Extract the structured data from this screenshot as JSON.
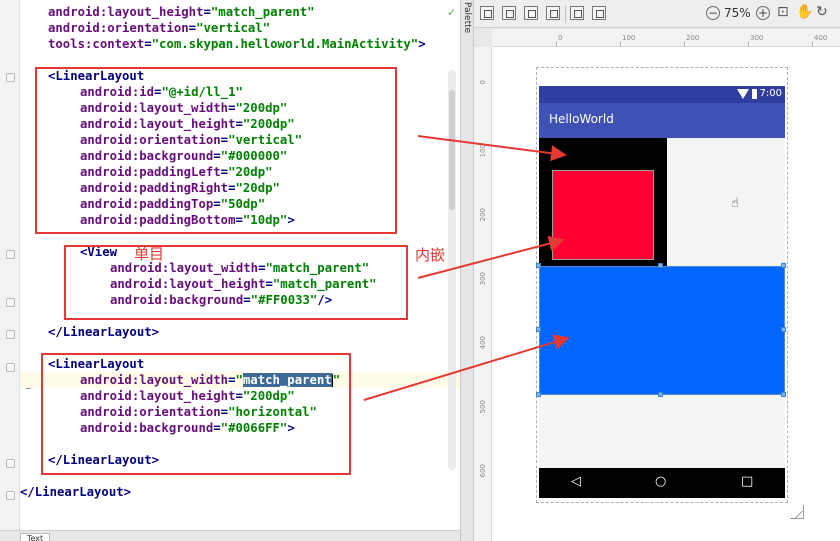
{
  "editor": {
    "lines": [
      {
        "parts": [
          {
            "t": "android:layout_height",
            "c": "attr"
          },
          {
            "t": "=",
            "c": "tag"
          },
          {
            "t": "\"match_parent\"",
            "c": "val"
          }
        ]
      },
      {
        "parts": [
          {
            "t": "android:orientation",
            "c": "attr"
          },
          {
            "t": "=",
            "c": "tag"
          },
          {
            "t": "\"vertical\"",
            "c": "val"
          }
        ]
      },
      {
        "parts": [
          {
            "t": "tools:context",
            "c": "attr"
          },
          {
            "t": "=",
            "c": "tag"
          },
          {
            "t": "\"com.skypan.helloworld.MainActivity\"",
            "c": "val"
          },
          {
            "t": ">",
            "c": "tag"
          }
        ]
      },
      {
        "parts": []
      },
      {
        "parts": [
          {
            "t": "<LinearLayout",
            "c": "tag"
          }
        ]
      },
      {
        "parts": [
          {
            "t": "android:id",
            "c": "attr"
          },
          {
            "t": "=",
            "c": "tag"
          },
          {
            "t": "\"@+id/ll_1\"",
            "c": "val"
          }
        ]
      },
      {
        "parts": [
          {
            "t": "android:layout_width",
            "c": "attr"
          },
          {
            "t": "=",
            "c": "tag"
          },
          {
            "t": "\"200dp\"",
            "c": "val"
          }
        ]
      },
      {
        "parts": [
          {
            "t": "android:layout_height",
            "c": "attr"
          },
          {
            "t": "=",
            "c": "tag"
          },
          {
            "t": "\"200dp\"",
            "c": "val"
          }
        ]
      },
      {
        "parts": [
          {
            "t": "android:orientation",
            "c": "attr"
          },
          {
            "t": "=",
            "c": "tag"
          },
          {
            "t": "\"vertical\"",
            "c": "val"
          }
        ]
      },
      {
        "parts": [
          {
            "t": "android:background",
            "c": "attr"
          },
          {
            "t": "=",
            "c": "tag"
          },
          {
            "t": "\"#000000\"",
            "c": "val"
          }
        ]
      },
      {
        "parts": [
          {
            "t": "android:paddingLeft",
            "c": "attr"
          },
          {
            "t": "=",
            "c": "tag"
          },
          {
            "t": "\"20dp\"",
            "c": "val"
          }
        ]
      },
      {
        "parts": [
          {
            "t": "android:paddingRight",
            "c": "attr"
          },
          {
            "t": "=",
            "c": "tag"
          },
          {
            "t": "\"20dp\"",
            "c": "val"
          }
        ]
      },
      {
        "parts": [
          {
            "t": "android:paddingTop",
            "c": "attr"
          },
          {
            "t": "=",
            "c": "tag"
          },
          {
            "t": "\"50dp\"",
            "c": "val"
          }
        ]
      },
      {
        "parts": [
          {
            "t": "android:paddingBottom",
            "c": "attr"
          },
          {
            "t": "=",
            "c": "tag"
          },
          {
            "t": "\"10dp\"",
            "c": "val"
          },
          {
            "t": ">",
            "c": "tag"
          }
        ]
      },
      {
        "parts": []
      },
      {
        "parts": [
          {
            "t": "<View",
            "c": "tag"
          }
        ]
      },
      {
        "parts": [
          {
            "t": "android:layout_width",
            "c": "attr"
          },
          {
            "t": "=",
            "c": "tag"
          },
          {
            "t": "\"match_parent\"",
            "c": "val"
          }
        ]
      },
      {
        "parts": [
          {
            "t": "android:layout_height",
            "c": "attr"
          },
          {
            "t": "=",
            "c": "tag"
          },
          {
            "t": "\"match_parent\"",
            "c": "val"
          }
        ]
      },
      {
        "parts": [
          {
            "t": "android:background",
            "c": "attr"
          },
          {
            "t": "=",
            "c": "tag"
          },
          {
            "t": "\"#FF0033\"",
            "c": "val"
          },
          {
            "t": "/>",
            "c": "tag"
          }
        ]
      },
      {
        "parts": []
      },
      {
        "parts": [
          {
            "t": "</LinearLayout>",
            "c": "tag"
          }
        ]
      },
      {
        "parts": []
      },
      {
        "parts": [
          {
            "t": "<LinearLayout",
            "c": "tag"
          }
        ]
      },
      {
        "parts": [
          {
            "t": "android:layout_width",
            "c": "attr"
          },
          {
            "t": "=",
            "c": "tag"
          },
          {
            "t": "\"",
            "c": "val"
          },
          {
            "t": "match_parent",
            "c": "sel"
          },
          {
            "t": "\"",
            "c": "val"
          }
        ]
      },
      {
        "parts": [
          {
            "t": "android:layout_height",
            "c": "attr"
          },
          {
            "t": "=",
            "c": "tag"
          },
          {
            "t": "\"200dp\"",
            "c": "val"
          }
        ]
      },
      {
        "parts": [
          {
            "t": "android:orientation",
            "c": "attr"
          },
          {
            "t": "=",
            "c": "tag"
          },
          {
            "t": "\"horizontal\"",
            "c": "val"
          }
        ]
      },
      {
        "parts": [
          {
            "t": "android:background",
            "c": "attr"
          },
          {
            "t": "=",
            "c": "tag"
          },
          {
            "t": "\"#0066FF\"",
            "c": "val"
          },
          {
            "t": ">",
            "c": "tag"
          }
        ]
      },
      {
        "parts": []
      },
      {
        "parts": [
          {
            "t": "</LinearLayout>",
            "c": "tag"
          }
        ]
      },
      {
        "parts": []
      },
      {
        "parts": [
          {
            "t": "</LinearLayout>",
            "c": "tag"
          }
        ]
      }
    ],
    "bottom_tab": "Text"
  },
  "annotations": {
    "single_label": "单目",
    "nested_label": "内嵌",
    "color": "#e53935"
  },
  "palette": {
    "label": "Palette"
  },
  "design": {
    "zoom": "75%",
    "zoom_out_symbol": "−",
    "zoom_in_symbol": "+",
    "ruler_top": [
      "0",
      "100",
      "200",
      "300",
      "400"
    ],
    "ruler_left": [
      "0",
      "100",
      "200",
      "300",
      "400",
      "500",
      "600"
    ],
    "status_time": "7:00",
    "app_title": "HelloWorld",
    "nav_back": "◁",
    "nav_home": "○",
    "nav_recent": "□",
    "colors": {
      "status_bar": "#303f9f",
      "app_bar": "#3f51b5",
      "ll_1_background": "#000000",
      "view_background": "#FF0033",
      "ll_2_background": "#0066FF"
    }
  }
}
